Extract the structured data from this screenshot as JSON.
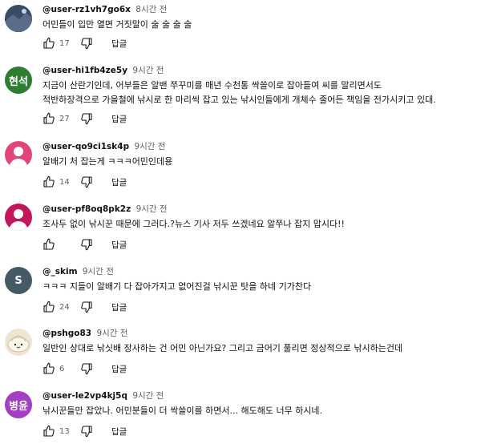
{
  "reply_label": "답글",
  "comments": [
    {
      "handle": "@user-rz1vh7go6x",
      "time": "8시간 전",
      "lines": [
        "어민들이 입만 열면 거짓말이 술 술 술 술"
      ],
      "likes": "17",
      "avatar": {
        "type": "photo",
        "label": ""
      }
    },
    {
      "handle": "@user-hi1fb4ze5y",
      "time": "9시간 전",
      "lines": [
        "지금이 산란기인데, 어부들은 알밴 쭈꾸미를 매년 수천통 싹쓸이로 잡아들여 씨를 말리면서도",
        "적반하장격으로 가을철에 낚시로 한 마리씩 잡고 있는 낚시인들에게 개체수 줄어든 책임을 전가시키고 있대."
      ],
      "likes": "27",
      "avatar": {
        "type": "text",
        "label": "현석",
        "color": "#2e7d32"
      }
    },
    {
      "handle": "@user-qo9ci1sk4p",
      "time": "9시간 전",
      "lines": [
        "알배기 처 잡는게 ㅋㅋㅋ어민인데용"
      ],
      "likes": "14",
      "avatar": {
        "type": "person",
        "label": "",
        "color": "#e0457b"
      }
    },
    {
      "handle": "@user-pf8oq8pk2z",
      "time": "9시간 전",
      "lines": [
        "조사두 없이 낚시꾼 때문에 그러다.?뉴스 기사 저두 쓰겠네요 알쭈나 잡지 맙시다!!"
      ],
      "likes": "",
      "avatar": {
        "type": "person",
        "label": "",
        "color": "#c2185b"
      }
    },
    {
      "handle": "@_skim",
      "time": "9시간 전",
      "lines": [
        "ㅋㅋㅋ 지들이 알배기 다 잡아가지고 없어진걸 낚시꾼 탓을 하네 기가찬다"
      ],
      "likes": "24",
      "avatar": {
        "type": "text",
        "label": "S",
        "color": "#455a64"
      }
    },
    {
      "handle": "@pshgo83",
      "time": "9시간 전",
      "lines": [
        "일반인 상대로 낚싯배 장사하는 건 어민 아닌가요? 그리고 금어기 풀리면 정상적으로 낚시하는건데"
      ],
      "likes": "6",
      "avatar": {
        "type": "dumpling",
        "label": ""
      }
    },
    {
      "handle": "@user-le2vp4kj5q",
      "time": "9시간 전",
      "lines": [
        "낚시꾼들만 잡았나. 어민분들이 더 싹쓸이를 하면서... 해도해도 너무 하시네."
      ],
      "likes": "13",
      "avatar": {
        "type": "text",
        "label": "병윤",
        "color": "#a23fc2"
      }
    }
  ]
}
